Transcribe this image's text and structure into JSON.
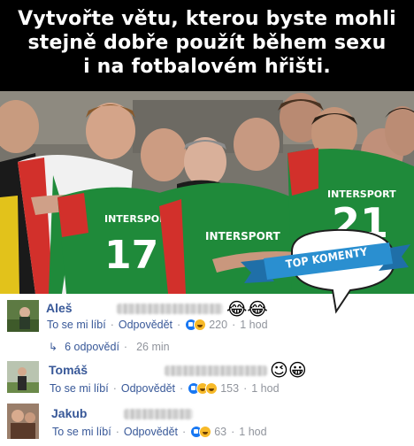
{
  "meme": {
    "caption_line1": "Vytvořte větu, kterou byste mohli",
    "caption_line2": "stejně dobře použít během sexu",
    "caption_line3": "i na fotbalovém hřišti.",
    "jersey_text": "INTERSPORT",
    "jersey_text_right": "INTERSPORT",
    "number_left": "17",
    "number_right": "21",
    "colors": {
      "green": "#1f8a3a",
      "red": "#d2302b",
      "white": "#f3f3f3",
      "caption_bg": "#000000"
    }
  },
  "badge": {
    "label": "TOP KOMENTY",
    "color": "#2a8fd0"
  },
  "comments": [
    {
      "author": "Aleš",
      "emoji": "😂😂",
      "like_label": "To se mi líbí",
      "reply_label": "Odpovědět",
      "reaction_count": "220",
      "time": "1 hod"
    },
    {
      "author": "Tomáš",
      "emoji": "😉😀",
      "like_label": "To se mi líbí",
      "reply_label": "Odpovědět",
      "reaction_count": "153",
      "time": "1 hod"
    },
    {
      "author": "Jakub",
      "emoji": "",
      "like_label": "To se mi líbí",
      "reply_label": "Odpovědět",
      "reaction_count": "63",
      "time": "1 hod"
    }
  ],
  "replies": {
    "label": "6 odpovědí",
    "time": "26 min"
  }
}
